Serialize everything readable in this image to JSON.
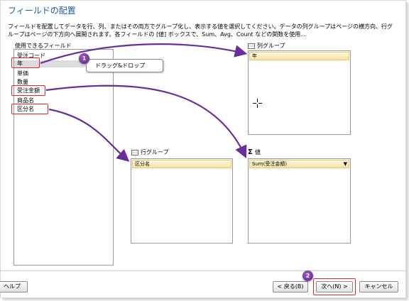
{
  "window": {
    "title": "フィールドの配置",
    "description": "フィールドを配置してデータを行、列、またはその両方でグループ化し、表示する値を選択してください。データの列グループはページの横方向、行グループはページの下方向へ展開されます。各フィールドの [値] ボックスで、Sum、Avg、Count などの関数を使用..."
  },
  "fields_panel": {
    "label": "使用できるフィールド",
    "items": [
      "受注コード",
      "年",
      "単価",
      "数量",
      "受注金額",
      "商品名",
      "区分名"
    ]
  },
  "callout": {
    "text": "ドラッグ&ドロップ"
  },
  "column_groups": {
    "label": "列グループ",
    "items": [
      "年"
    ]
  },
  "row_groups": {
    "label": "行グループ",
    "items": [
      "区分名"
    ]
  },
  "values": {
    "label": "値",
    "items": [
      "Sum(受注金額)"
    ]
  },
  "badges": [
    "1",
    "2"
  ],
  "footer": {
    "help": "ヘルプ",
    "back": "< 戻る(B)",
    "next": "次へ(N) >",
    "cancel": "キャンセル"
  },
  "colors": {
    "title": "#1e5aa0",
    "highlight": "#e0262c",
    "arrow": "#6a2c9e",
    "chip": "#f7e3a6"
  },
  "icons": [
    "grid-icon",
    "sigma-icon",
    "crosshair-cursor-icon",
    "dropdown-arrow-icon"
  ]
}
